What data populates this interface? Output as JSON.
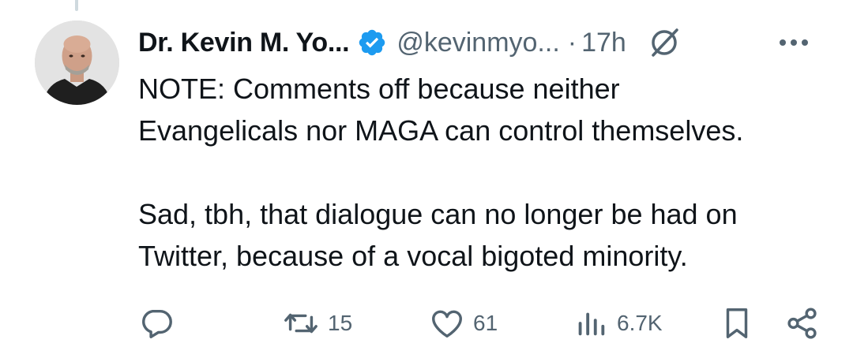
{
  "tweet": {
    "author_name": "Dr. Kevin M. Yo...",
    "handle": "@kevinmyo...",
    "separator": "·",
    "time": "17h",
    "body_lines": [
      "NOTE:  Comments off because neither",
      "Evangelicals nor MAGA can control themselves.",
      "Sad, tbh, that dialogue can no longer be had on",
      "Twitter, because of a vocal bigoted minority."
    ]
  },
  "actions": {
    "replies": "",
    "retweets": "15",
    "likes": "61",
    "views": "6.7K"
  },
  "colors": {
    "verified": "#1d9bf0",
    "muted": "#536471",
    "text": "#0f1419"
  },
  "icons": [
    "verified-badge-icon",
    "grok-icon",
    "more-icon",
    "reply-icon",
    "retweet-icon",
    "like-icon",
    "views-icon",
    "bookmark-icon",
    "share-icon"
  ]
}
